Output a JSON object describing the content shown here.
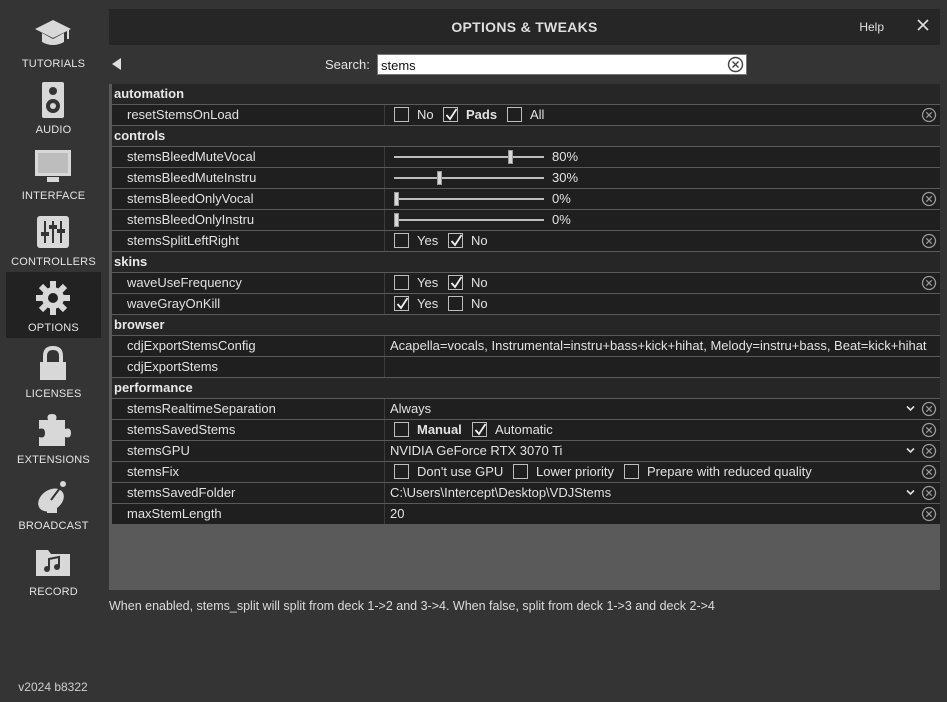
{
  "sidebar": {
    "items": [
      {
        "label": "TUTORIALS",
        "icon": "graduation-cap-icon"
      },
      {
        "label": "AUDIO",
        "icon": "speaker-icon"
      },
      {
        "label": "INTERFACE",
        "icon": "monitor-icon"
      },
      {
        "label": "CONTROLLERS",
        "icon": "sliders-icon"
      },
      {
        "label": "OPTIONS",
        "icon": "gear-icon"
      },
      {
        "label": "LICENSES",
        "icon": "lock-icon"
      },
      {
        "label": "EXTENSIONS",
        "icon": "puzzle-icon"
      },
      {
        "label": "BROADCAST",
        "icon": "satellite-dish-icon"
      },
      {
        "label": "RECORD",
        "icon": "music-folder-icon"
      }
    ],
    "active": "OPTIONS",
    "version": "v2024 b8322"
  },
  "window": {
    "title": "OPTIONS & TWEAKS",
    "help": "Help"
  },
  "search": {
    "label": "Search:",
    "value": "stems"
  },
  "groups": {
    "automation": "automation",
    "controls": "controls",
    "skins": "skins",
    "browser": "browser",
    "performance": "performance"
  },
  "rows": {
    "resetStemsOnLoad": {
      "name": "resetStemsOnLoad",
      "options": [
        "No",
        "Pads",
        "All"
      ],
      "checked": "Pads"
    },
    "stemsBleedMuteVocal": {
      "name": "stemsBleedMuteVocal",
      "value": "80%",
      "level": 0.8
    },
    "stemsBleedMuteInstru": {
      "name": "stemsBleedMuteInstru",
      "value": "30%",
      "level": 0.3
    },
    "stemsBleedOnlyVocal": {
      "name": "stemsBleedOnlyVocal",
      "value": "0%",
      "level": 0
    },
    "stemsBleedOnlyInstru": {
      "name": "stemsBleedOnlyInstru",
      "value": "0%",
      "level": 0
    },
    "stemsSplitLeftRight": {
      "name": "stemsSplitLeftRight",
      "options": [
        "Yes",
        "No"
      ],
      "checked": "No"
    },
    "waveUseFrequency": {
      "name": "waveUseFrequency",
      "options": [
        "Yes",
        "No"
      ],
      "checked": "No"
    },
    "waveGrayOnKill": {
      "name": "waveGrayOnKill",
      "options": [
        "Yes",
        "No"
      ],
      "checked": "Yes"
    },
    "cdjExportStemsConfig": {
      "name": "cdjExportStemsConfig",
      "value": "Acapella=vocals, Instrumental=instru+bass+kick+hihat, Melody=instru+bass, Beat=kick+hihat"
    },
    "cdjExportStems": {
      "name": "cdjExportStems",
      "value": ""
    },
    "stemsRealtimeSeparation": {
      "name": "stemsRealtimeSeparation",
      "value": "Always"
    },
    "stemsSavedStems": {
      "name": "stemsSavedStems",
      "options": [
        "Manual",
        "Automatic"
      ],
      "checked": "Automatic"
    },
    "stemsGPU": {
      "name": "stemsGPU",
      "value": "NVIDIA GeForce RTX 3070 Ti"
    },
    "stemsFix": {
      "name": "stemsFix",
      "options": [
        "Don't use GPU",
        "Lower priority",
        "Prepare with reduced quality"
      ],
      "checked": ""
    },
    "stemsSavedFolder": {
      "name": "stemsSavedFolder",
      "value": "C:\\Users\\Intercept\\Desktop\\VDJStems"
    },
    "maxStemLength": {
      "name": "maxStemLength",
      "value": "20"
    }
  },
  "footer": {
    "description": "When enabled, stems_split will split from deck 1->2 and 3->4. When false, split from deck 1->3 and deck 2->4"
  },
  "colors": {
    "background": "#343434",
    "row": "#1f1f1f",
    "group": "#262626",
    "empty_area": "#5a5a5a"
  }
}
